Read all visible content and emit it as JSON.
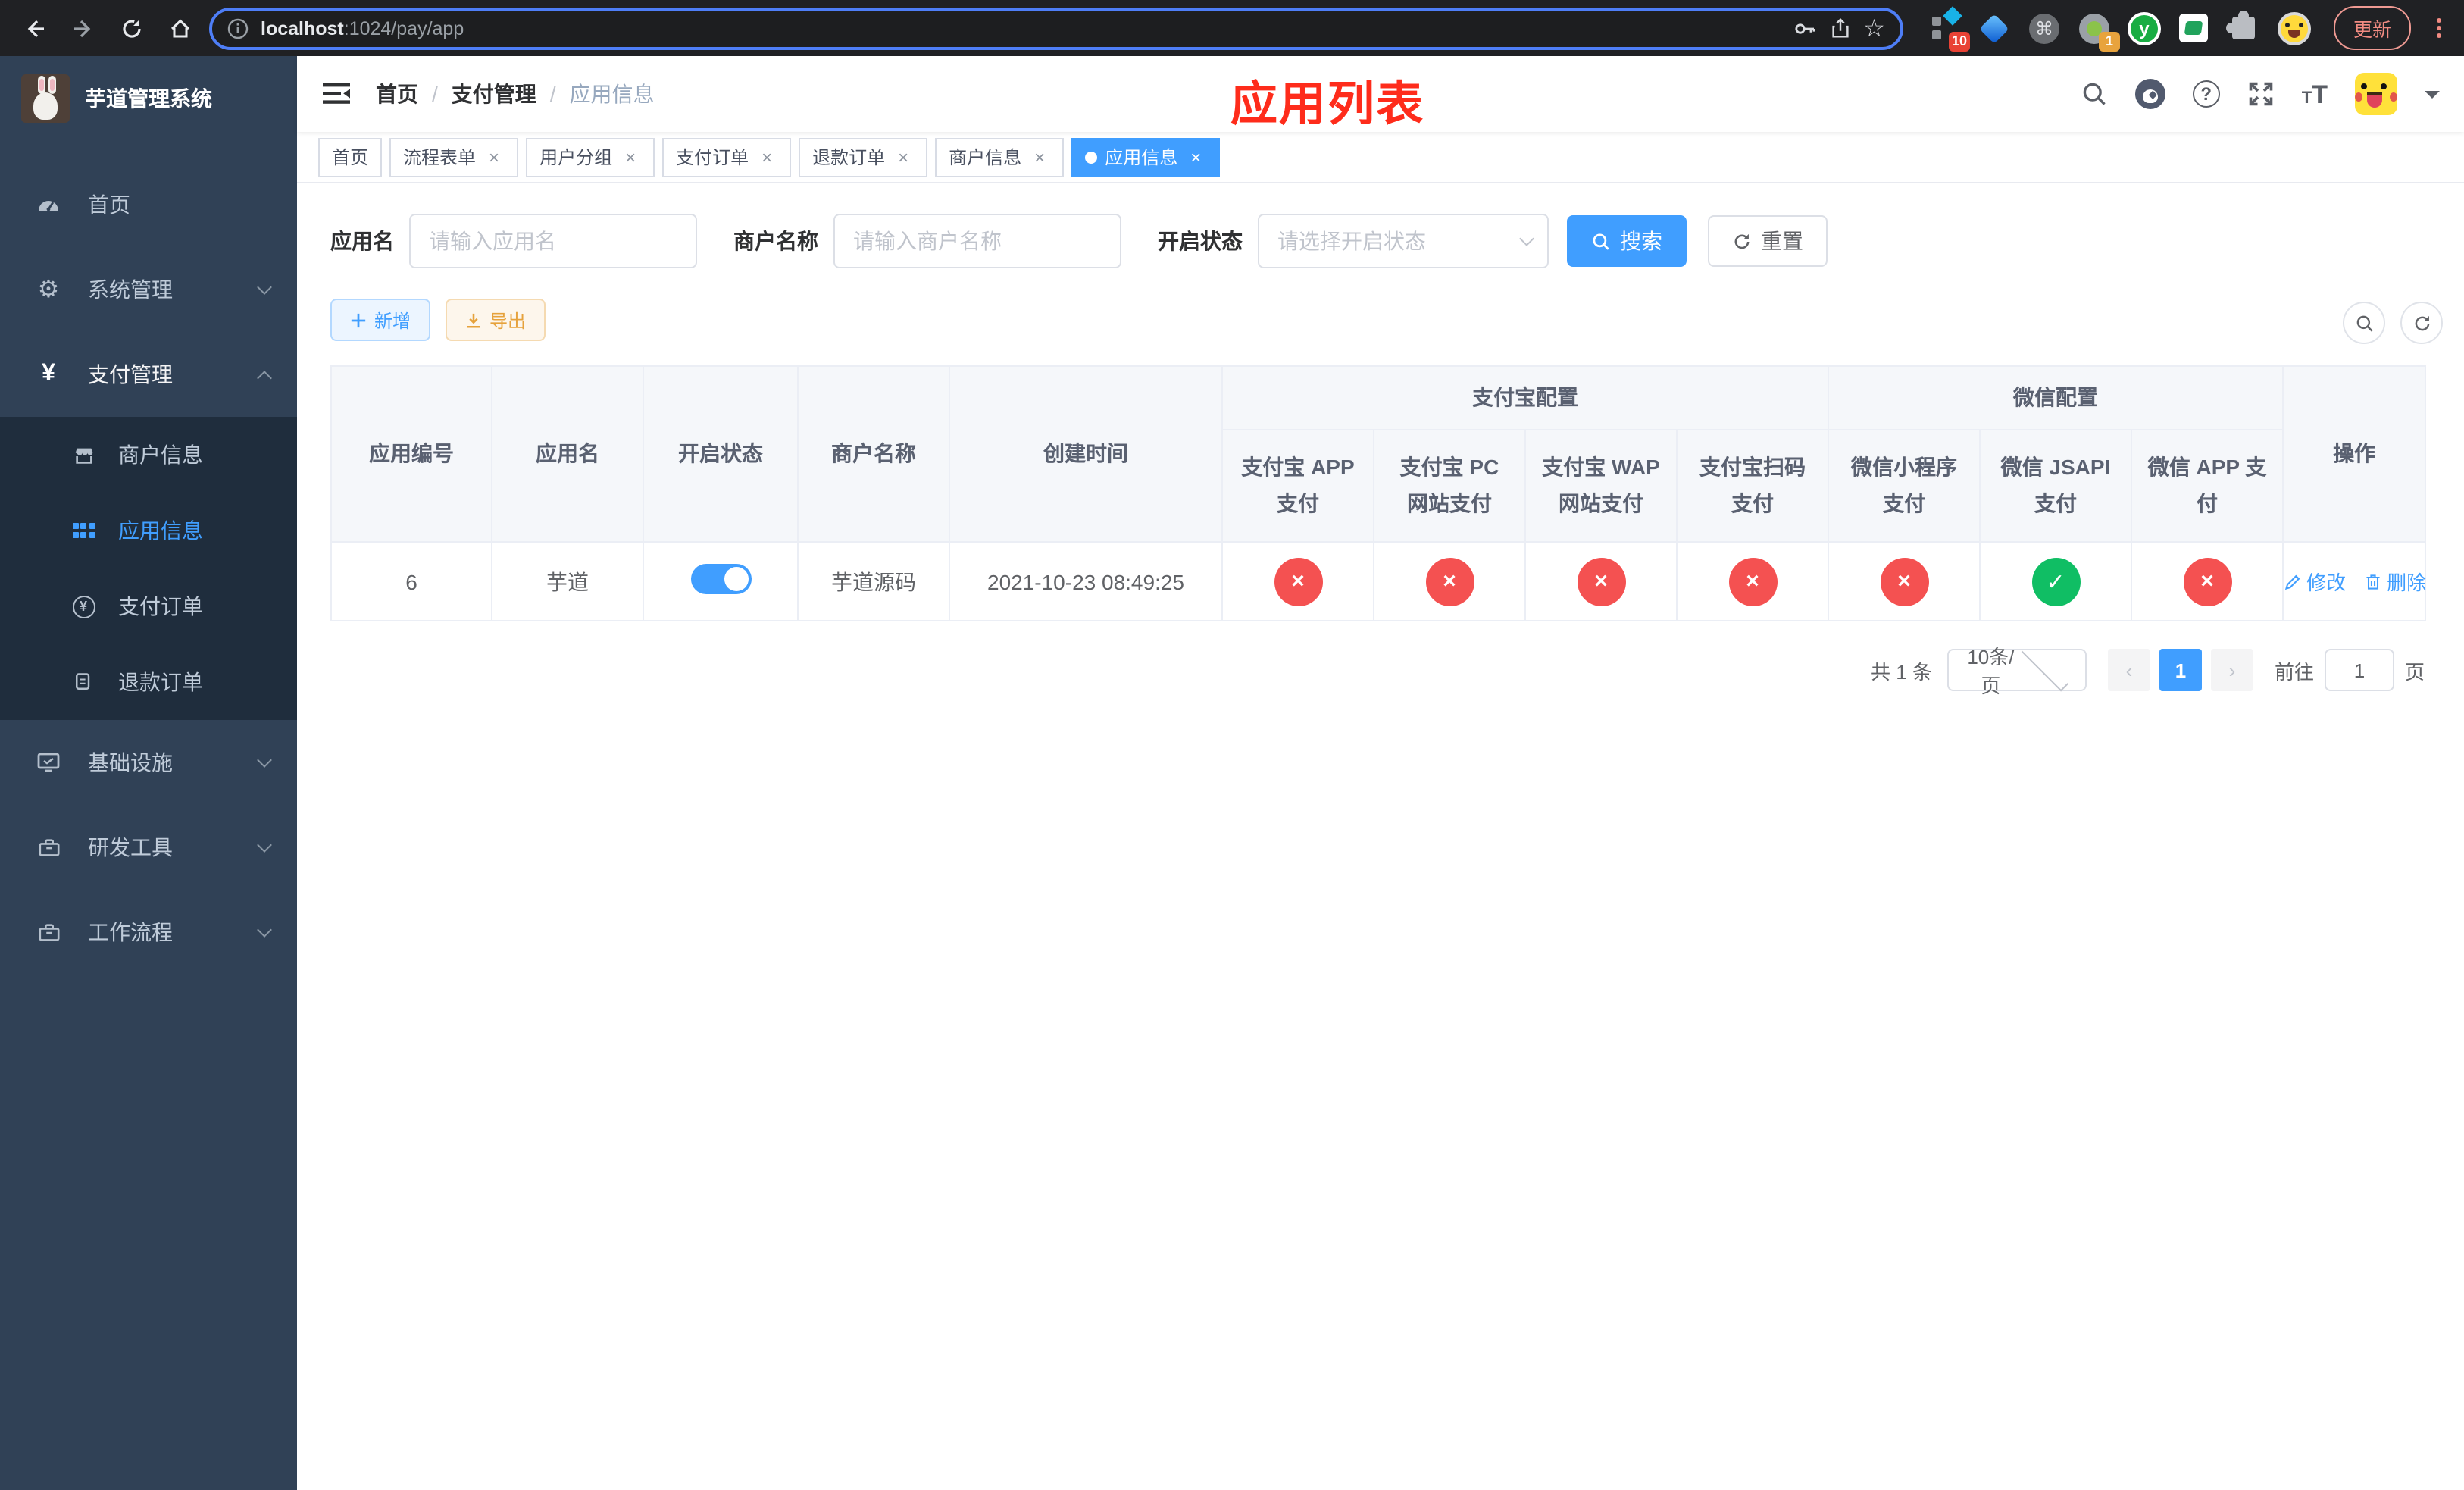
{
  "browser": {
    "url_host": "localhost",
    "url_path": ":1024/pay/app",
    "update_label": "更新",
    "ext_badge_apps": "10",
    "ext_badge_rec": "1",
    "ext_y_letter": "y",
    "ext_cmd_glyph": "⌘"
  },
  "sidebar": {
    "title": "芋道管理系统",
    "home": "首页",
    "system": "系统管理",
    "payment": "支付管理",
    "sub_merchant": "商户信息",
    "sub_app": "应用信息",
    "sub_pay_order": "支付订单",
    "sub_refund_order": "退款订单",
    "infra": "基础设施",
    "devtools": "研发工具",
    "workflow": "工作流程",
    "yen_glyph": "¥",
    "gear_glyph": "⚙"
  },
  "header": {
    "crumb_home": "首页",
    "crumb_payment": "支付管理",
    "crumb_app": "应用信息",
    "separator": "/",
    "overlay_title": "应用列表",
    "text_size_small": "T",
    "text_size_large": "T",
    "question_glyph": "?"
  },
  "tabs": [
    {
      "label": "首页",
      "closable": false,
      "active": false
    },
    {
      "label": "流程表单",
      "closable": true,
      "active": false
    },
    {
      "label": "用户分组",
      "closable": true,
      "active": false
    },
    {
      "label": "支付订单",
      "closable": true,
      "active": false
    },
    {
      "label": "退款订单",
      "closable": true,
      "active": false
    },
    {
      "label": "商户信息",
      "closable": true,
      "active": false
    },
    {
      "label": "应用信息",
      "closable": true,
      "active": true
    }
  ],
  "tab_close_glyph": "×",
  "filters": {
    "app_name_label": "应用名",
    "app_name_placeholder": "请输入应用名",
    "merchant_label": "商户名称",
    "merchant_placeholder": "请输入商户名称",
    "status_label": "开启状态",
    "status_placeholder": "请选择开启状态",
    "search_label": "搜索",
    "reset_label": "重置"
  },
  "toolbar": {
    "add_label": "新增",
    "export_label": "导出"
  },
  "table": {
    "col_app_id": "应用编号",
    "col_app_name": "应用名",
    "col_status": "开启状态",
    "col_merchant": "商户名称",
    "col_created": "创建时间",
    "group_alipay": "支付宝配置",
    "group_wechat": "微信配置",
    "col_alipay_app": "支付宝 APP 支付",
    "col_alipay_pc": "支付宝 PC 网站支付",
    "col_alipay_wap": "支付宝 WAP 网站支付",
    "col_alipay_qr": "支付宝扫码支付",
    "col_wx_mini": "微信小程序支付",
    "col_wx_jsapi": "微信 JSAPI 支付",
    "col_wx_app": "微信 APP 支付",
    "col_actions": "操作",
    "row": {
      "id": "6",
      "name": "芋道",
      "enabled": true,
      "merchant": "芋道源码",
      "created": "2021-10-23 08:49:25",
      "statuses": [
        false,
        false,
        false,
        false,
        false,
        true,
        false
      ],
      "edit_label": "修改",
      "delete_label": "删除"
    }
  },
  "pagination": {
    "total_label": "共 1 条",
    "page_size_label": "10条/页",
    "prev_glyph": "‹",
    "next_glyph": "›",
    "current_page": "1",
    "goto_label": "前往",
    "goto_value": "1",
    "page_suffix": "页"
  },
  "colors": {
    "accent": "#409eff",
    "danger": "#f45151",
    "success": "#10be64",
    "warning": "#e6a23c",
    "overlay_red": "#fe2c1b",
    "sidebar_bg": "#304156",
    "submenu_bg": "#1f2d3d"
  }
}
